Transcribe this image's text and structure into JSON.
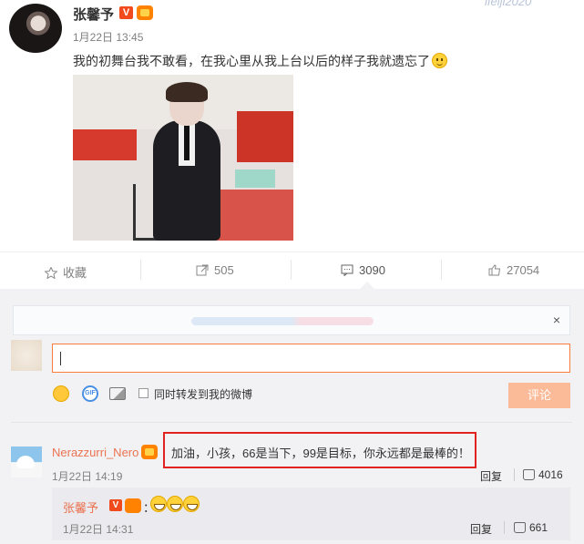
{
  "post": {
    "author": "张馨予",
    "time": "1月22日 13:45",
    "text": "我的初舞台我不敢看，在我心里从我上台以后的样子我就遗忘了",
    "watermark": "ifeiji2020"
  },
  "actions": {
    "favorite_label": "收藏",
    "repost_count": "505",
    "comment_count": "3090",
    "like_count": "27054"
  },
  "composer": {
    "notice_close": "×",
    "sync_label": "同时转发到我的微博",
    "submit_label": "评论",
    "gif_label": "GIF"
  },
  "comment": {
    "user": "Nerazzurri_Nero",
    "text": "加油，小孩，66是当下，99是目标，你永远都是最棒的！",
    "time": "1月22日 14:19",
    "reply_label": "回复",
    "likes": "4016"
  },
  "reply": {
    "user": "张馨予",
    "colon": "：",
    "time": "1月22日 14:31",
    "reply_label": "回复",
    "likes": "661"
  },
  "colors": {
    "accent_orange": "#fa7d3c",
    "name_link": "#eb7350",
    "highlight_box": "#e0231f"
  }
}
